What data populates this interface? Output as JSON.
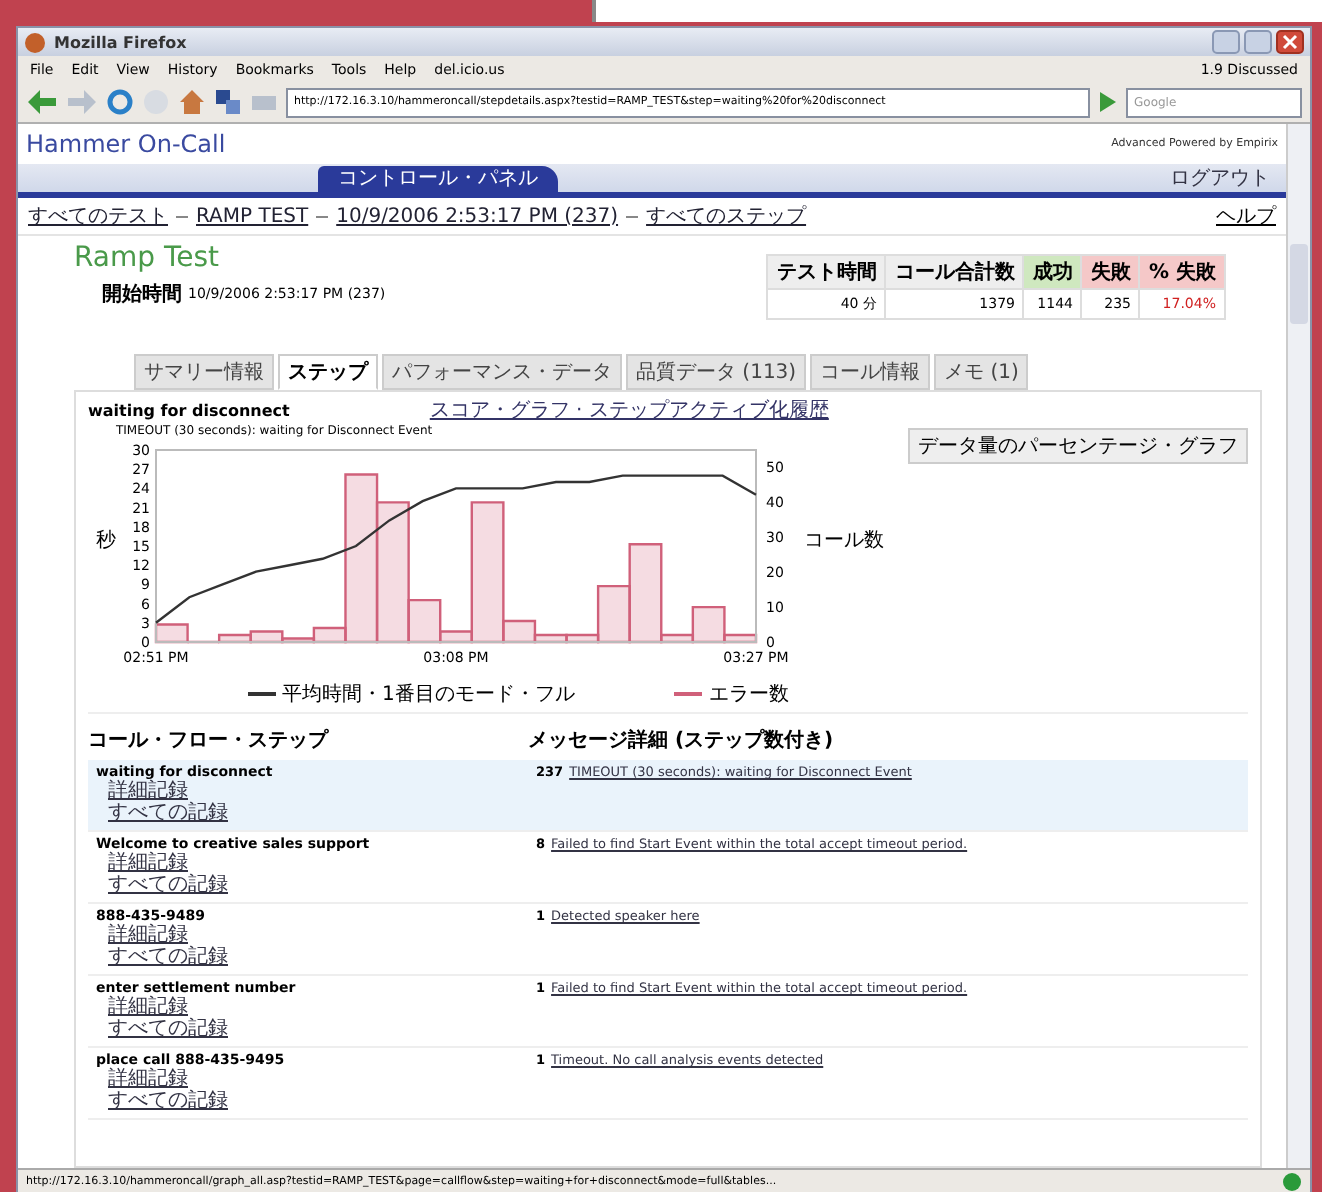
{
  "window": {
    "title": "Mozilla Firefox"
  },
  "menu": [
    "File",
    "Edit",
    "View",
    "History",
    "Bookmarks",
    "Tools",
    "Help",
    "del.icio.us"
  ],
  "menu_right": "1.9 Discussed",
  "address": {
    "value": "http://172.16.3.10/hammeroncall/stepdetails.aspx?testid=RAMP_TEST&step=waiting%20for%20disconnect"
  },
  "search": {
    "placeholder": "Google"
  },
  "app": {
    "name": "Hammer On-Call",
    "powered": "Advanced Powered by Empirix",
    "tab": "コントロール・パネル",
    "logout": "ログアウト"
  },
  "breadcrumbs": [
    "すべてのテスト",
    "RAMP TEST",
    "10/9/2006 2:53:17 PM (237)",
    "すべてのステップ"
  ],
  "help": "ヘルプ",
  "test": {
    "title": "Ramp Test",
    "start_label": "開始時間",
    "start": "10/9/2006 2:53:17 PM (237)"
  },
  "stats": {
    "columns": [
      {
        "label": "テスト時間",
        "kind": "plain"
      },
      {
        "label": "コール合計数",
        "kind": "plain"
      },
      {
        "label": "成功",
        "kind": "ok"
      },
      {
        "label": "失敗",
        "kind": "fail"
      },
      {
        "label": "% 失敗",
        "kind": "pct"
      }
    ],
    "values": [
      "40 分",
      "1379",
      "1144",
      "235",
      "17.04%"
    ]
  },
  "tabs": [
    {
      "label": "サマリー情報",
      "selected": false
    },
    {
      "label": "ステップ",
      "selected": true
    },
    {
      "label": "パフォーマンス・データ",
      "selected": false
    },
    {
      "label": "品質データ (113)",
      "selected": false
    },
    {
      "label": "コール情報",
      "selected": false
    },
    {
      "label": "メモ (1)",
      "selected": false
    }
  ],
  "step": {
    "name": "waiting for disconnect",
    "links": "スコア・グラフ · ステップアクティブ化履歴",
    "message": "TIMEOUT (30 seconds): waiting for Disconnect Event",
    "graph_button": "データ量のパーセンテージ・グラフ",
    "chart_data": {
      "type": "line",
      "ylabel": "秒",
      "categories": [
        "02:51 PM",
        null,
        null,
        null,
        null,
        null,
        null,
        null,
        null,
        "03:08 PM",
        null,
        null,
        null,
        null,
        null,
        null,
        null,
        null,
        "03:27 PM"
      ],
      "ylim": [
        0,
        30
      ],
      "yticks": [
        0,
        3,
        6,
        9,
        12,
        15,
        18,
        21,
        24,
        27,
        30
      ],
      "series": [
        {
          "name": "平均時間・1番目のモード・フル",
          "color": "#333333",
          "values": [
            3,
            7,
            9,
            11,
            12,
            13,
            15,
            19,
            22,
            24,
            24,
            24,
            25,
            25,
            26,
            26,
            26,
            26,
            23
          ]
        }
      ]
    },
    "errors": {
      "chart_data": {
        "type": "bar",
        "ylabel": "コール数",
        "categories": [
          null,
          null,
          null,
          null,
          null,
          null,
          null,
          null,
          null,
          null,
          null,
          null,
          null,
          null,
          null,
          null,
          null,
          null,
          null
        ],
        "ylim": [
          0,
          55
        ],
        "yticks": [
          0,
          10,
          20,
          30,
          40,
          50
        ],
        "series": [
          {
            "name": "エラー数",
            "color": "#d0607a",
            "values": [
              5,
              0,
              2,
              3,
              1,
              4,
              48,
              40,
              12,
              3,
              40,
              6,
              2,
              2,
              16,
              28,
              2,
              10,
              2
            ]
          }
        ]
      }
    }
  },
  "steps": {
    "columns": [
      "コール・フロー・ステップ",
      "メッセージ詳細 (ステップ数付き)"
    ],
    "rows": [
      {
        "name": "waiting for disconnect",
        "links": [
          "詳細記録",
          "すべての記録"
        ],
        "count": "237",
        "message": "TIMEOUT (30 seconds): waiting for Disconnect Event",
        "selected": true
      },
      {
        "name": "Welcome to creative sales support",
        "links": [
          "詳細記録",
          "すべての記録"
        ],
        "count": "8",
        "message": "Failed to find Start Event within the total accept timeout period.",
        "selected": false
      },
      {
        "name": "888-435-9489",
        "links": [
          "詳細記録",
          "すべての記録"
        ],
        "count": "1",
        "message": "Detected speaker here",
        "selected": false
      },
      {
        "name": "enter settlement number",
        "links": [
          "詳細記録",
          "すべての記録"
        ],
        "count": "1",
        "message": "Failed to find Start Event within the total accept timeout period.",
        "selected": false
      },
      {
        "name": "place call 888-435-9495",
        "links": [
          "詳細記録",
          "すべての記録"
        ],
        "count": "1",
        "message": "Timeout. No call analysis events detected",
        "selected": false
      }
    ]
  },
  "status_bar": "http://172.16.3.10/hammeroncall/graph_all.asp?testid=RAMP_TEST&page=callflow&step=waiting+for+disconnect&mode=full&tables..."
}
